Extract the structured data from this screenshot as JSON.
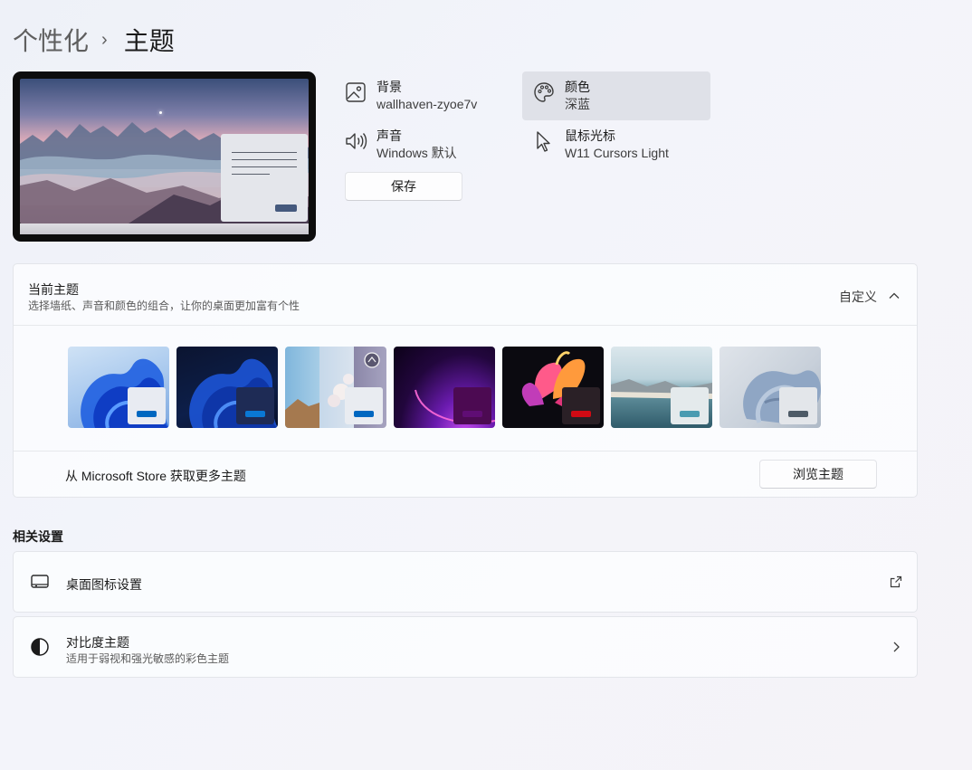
{
  "breadcrumb": {
    "parent": "个性化",
    "separator": "›",
    "current": "主题"
  },
  "quick": {
    "background": {
      "label": "背景",
      "value": "wallhaven-zyoe7v"
    },
    "color": {
      "label": "颜色",
      "value": "深蓝"
    },
    "sound": {
      "label": "声音",
      "value": "Windows 默认"
    },
    "cursor": {
      "label": "鼠标光标",
      "value": "W11 Cursors Light"
    },
    "save_label": "保存"
  },
  "current_theme": {
    "title": "当前主题",
    "subtitle": "选择墙纸、声音和颜色的组合，让你的桌面更加富有个性",
    "status": "自定义",
    "themes": [
      {
        "name": "windows-light",
        "accent": "#0067c0",
        "mini_bg": "#e8ebf2"
      },
      {
        "name": "windows-dark",
        "accent": "#0a78d4",
        "mini_bg": "#1e2b55"
      },
      {
        "name": "windows-spotlight",
        "accent": "#0067c0",
        "mini_bg": "#e9ecf1"
      },
      {
        "name": "glow",
        "accent": "#5f0d74",
        "mini_bg": "#4c0a52"
      },
      {
        "name": "captured-motion",
        "accent": "#d10a14",
        "mini_bg": "#2a2026"
      },
      {
        "name": "sunrise",
        "accent": "#4a9bb1",
        "mini_bg": "#e4eaec"
      },
      {
        "name": "flow",
        "accent": "#4e5b67",
        "mini_bg": "#e3e6ea"
      }
    ],
    "store_text": "从 Microsoft Store 获取更多主题",
    "browse_label": "浏览主题"
  },
  "related": {
    "title": "相关设置",
    "desktop_icons": {
      "label": "桌面图标设置"
    },
    "contrast": {
      "label": "对比度主题",
      "subtitle": "适用于弱视和强光敏感的彩色主题"
    }
  },
  "colors": {
    "selected_bg": "#dfe1e8",
    "card_border": "#e3e5ea"
  }
}
